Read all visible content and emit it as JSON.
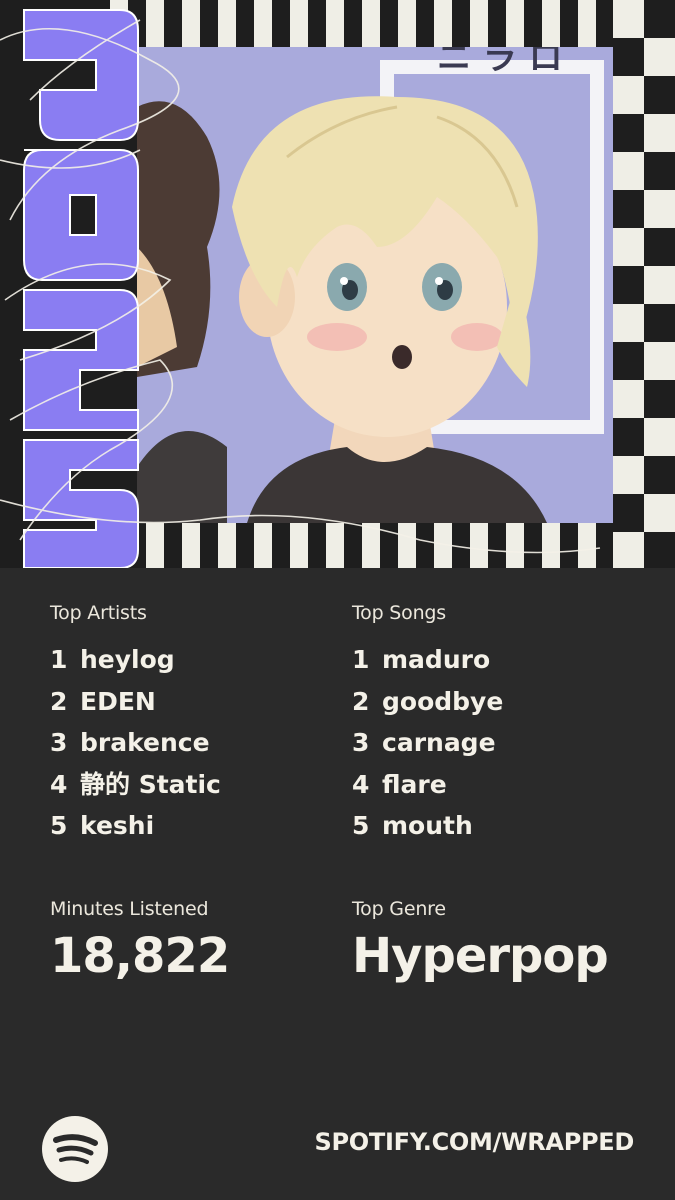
{
  "year_graphic": "2025",
  "colors": {
    "background": "#2a2a2a",
    "accent": "#8a7df2",
    "text": "#f4f1e8",
    "cover_bg": "#a8a8de"
  },
  "top_artists": {
    "label": "Top Artists",
    "items": [
      {
        "rank": "1",
        "name": "heylog"
      },
      {
        "rank": "2",
        "name": "EDEN"
      },
      {
        "rank": "3",
        "name": "brakence"
      },
      {
        "rank": "4",
        "name": "静的 Static"
      },
      {
        "rank": "5",
        "name": "keshi"
      }
    ]
  },
  "top_songs": {
    "label": "Top Songs",
    "items": [
      {
        "rank": "1",
        "name": "maduro"
      },
      {
        "rank": "2",
        "name": "goodbye"
      },
      {
        "rank": "3",
        "name": "carnage"
      },
      {
        "rank": "4",
        "name": "flare"
      },
      {
        "rank": "5",
        "name": "mouth"
      }
    ]
  },
  "minutes": {
    "label": "Minutes Listened",
    "value": "18,822"
  },
  "genre": {
    "label": "Top Genre",
    "value": "Hyperpop"
  },
  "footer": {
    "url": "SPOTIFY.COM/WRAPPED",
    "logo_icon": "spotify-logo-icon"
  }
}
